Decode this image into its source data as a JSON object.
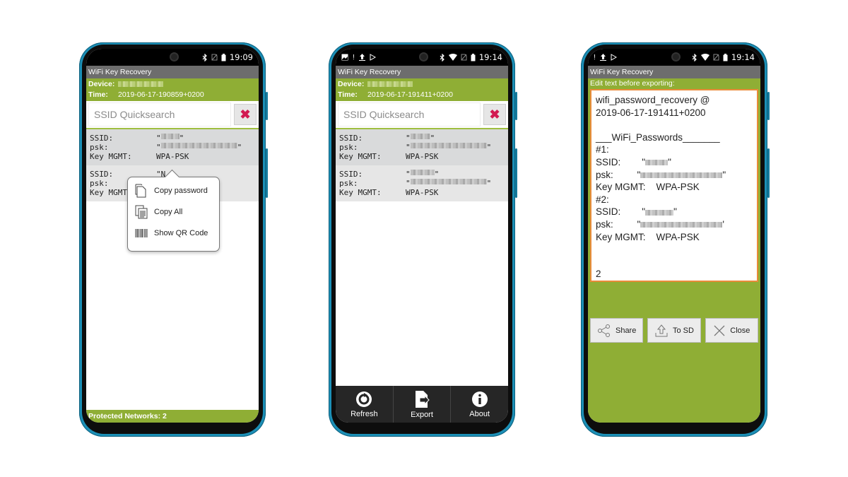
{
  "colors": {
    "accent_green": "#8fae35",
    "phone_frame": "#1c8fb6",
    "title_gray": "#6d6d6d",
    "clear_red": "#d21a52",
    "edit_border": "#e98b3a"
  },
  "phones": [
    {
      "status": {
        "left_icons": [],
        "clock": "19:09"
      },
      "app_title": "WiFi Key Recovery",
      "device_label": "Device:",
      "time_label": "Time:",
      "time_value": "2019-06-17-190859+0200",
      "search_placeholder": "SSID Quicksearch",
      "clear_icon": "close-x-icon",
      "networks": [
        {
          "ssid_label": "SSID:",
          "psk_label": "psk:",
          "mgmt_label": "Key MGMT:",
          "ssid": "\"",
          "psk": "\"",
          "mgmt": "WPA-PSK"
        },
        {
          "ssid_label": "SSID:",
          "psk_label": "psk:",
          "mgmt_label": "Key MGMT",
          "ssid": "\"N",
          "psk": "\"",
          "mgmt": ""
        }
      ],
      "context_menu": [
        {
          "label": "Copy password",
          "icon": "copy-icon"
        },
        {
          "label": "Copy All",
          "icon": "copy-all-icon"
        },
        {
          "label": "Show QR Code",
          "icon": "barcode-icon"
        }
      ],
      "footer": "Protected Networks:  2"
    },
    {
      "status": {
        "clock": "19:14"
      },
      "app_title": "WiFi Key Recovery",
      "device_label": "Device:",
      "time_label": "Time:",
      "time_value": "2019-06-17-191411+0200",
      "search_placeholder": "SSID Quicksearch",
      "networks": [
        {
          "ssid_label": "SSID:",
          "psk_label": "psk:",
          "mgmt_label": "Key MGMT:",
          "ssid": "\"",
          "psk": "\"",
          "mgmt": "WPA-PSK"
        },
        {
          "ssid_label": "SSID:",
          "psk_label": "psk:",
          "mgmt_label": "Key MGMT:",
          "ssid": "\"",
          "psk": "\"",
          "mgmt": "WPA-PSK"
        }
      ],
      "bottom_actions": [
        {
          "label": "Refresh",
          "icon": "refresh-icon"
        },
        {
          "label": "Export",
          "icon": "export-icon"
        },
        {
          "label": "About",
          "icon": "info-icon"
        }
      ]
    },
    {
      "status": {
        "clock": "19:14"
      },
      "app_title": "WiFi Key Recovery",
      "edit_hint": "Edit text before exporting:",
      "export_lines": [
        "wifi_password_recovery @",
        "2019-06-17-191411+0200",
        "",
        "___WiFi_Passwords_______",
        "#1:",
        "SSID:        \"",
        "psk:         \"",
        "Key MGMT:    WPA-PSK",
        "#2:",
        "SSID:        \"",
        "psk:         \"",
        "Key MGMT:    WPA-PSK",
        "",
        "",
        "2"
      ],
      "actions": [
        {
          "label": "Share",
          "icon": "share-icon"
        },
        {
          "label": "To SD",
          "icon": "upload-icon"
        },
        {
          "label": "Close",
          "icon": "close-icon"
        }
      ]
    }
  ]
}
